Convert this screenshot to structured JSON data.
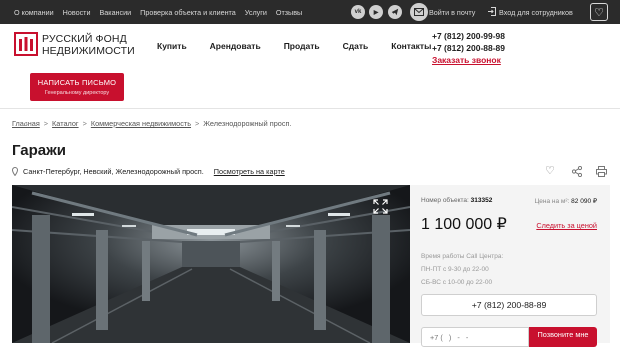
{
  "topbar": {
    "nav": [
      "О компании",
      "Новости",
      "Вакансии",
      "Проверка объекта и клиента",
      "Услуги",
      "Отзывы"
    ],
    "social": [
      {
        "icon": "vk-icon",
        "label": "vk"
      },
      {
        "icon": "youtube-icon",
        "label": "▶"
      }
    ],
    "mail_label": "Войти в почту",
    "staff_label": "Вход для сотрудников"
  },
  "header": {
    "logo_line1": "РУССКИЙ ФОНД",
    "logo_line2": "НЕДВИЖИМОСТИ",
    "nav": [
      "Купить",
      "Арендовать",
      "Продать",
      "Сдать",
      "Контакты"
    ],
    "phone1": "+7 (812) 200-99-98",
    "phone2": "+7 (812) 200-88-89",
    "callback": "Заказать звонок",
    "write_btn": "НАПИСАТЬ ПИСЬМО",
    "write_sub": "Генеральному директору"
  },
  "breadcrumbs": [
    "Главная",
    "Каталог",
    "Коммерческая недвижимость",
    "Железнодорожный просп."
  ],
  "page": {
    "title": "Гаражи",
    "address": "Санкт-Петербург, Невский, Железнодорожный просп.",
    "map_link": "Посмотреть на карте"
  },
  "panel": {
    "obj_label": "Номер объекта:",
    "obj_number": "313352",
    "ppm_label": "Цена на м²:",
    "ppm_value": "82 090 ₽",
    "price": "1 100 000 ₽",
    "follow": "Следить за ценой",
    "hours_title": "Время работы Call Центра:",
    "hours_weekdays": "ПН-ПТ с 9-30 до 22-00",
    "hours_weekend": "СБ-ВС с 10-00 до 22-00",
    "phone_btn": "+7 (812) 200-88-89",
    "input_placeholder": "+7 (   )   -   -  ",
    "call_btn": "Позвоните мне"
  },
  "colors": {
    "accent": "#c8102e",
    "topbar": "#2b2b2b",
    "panel": "#f4f4f4"
  }
}
